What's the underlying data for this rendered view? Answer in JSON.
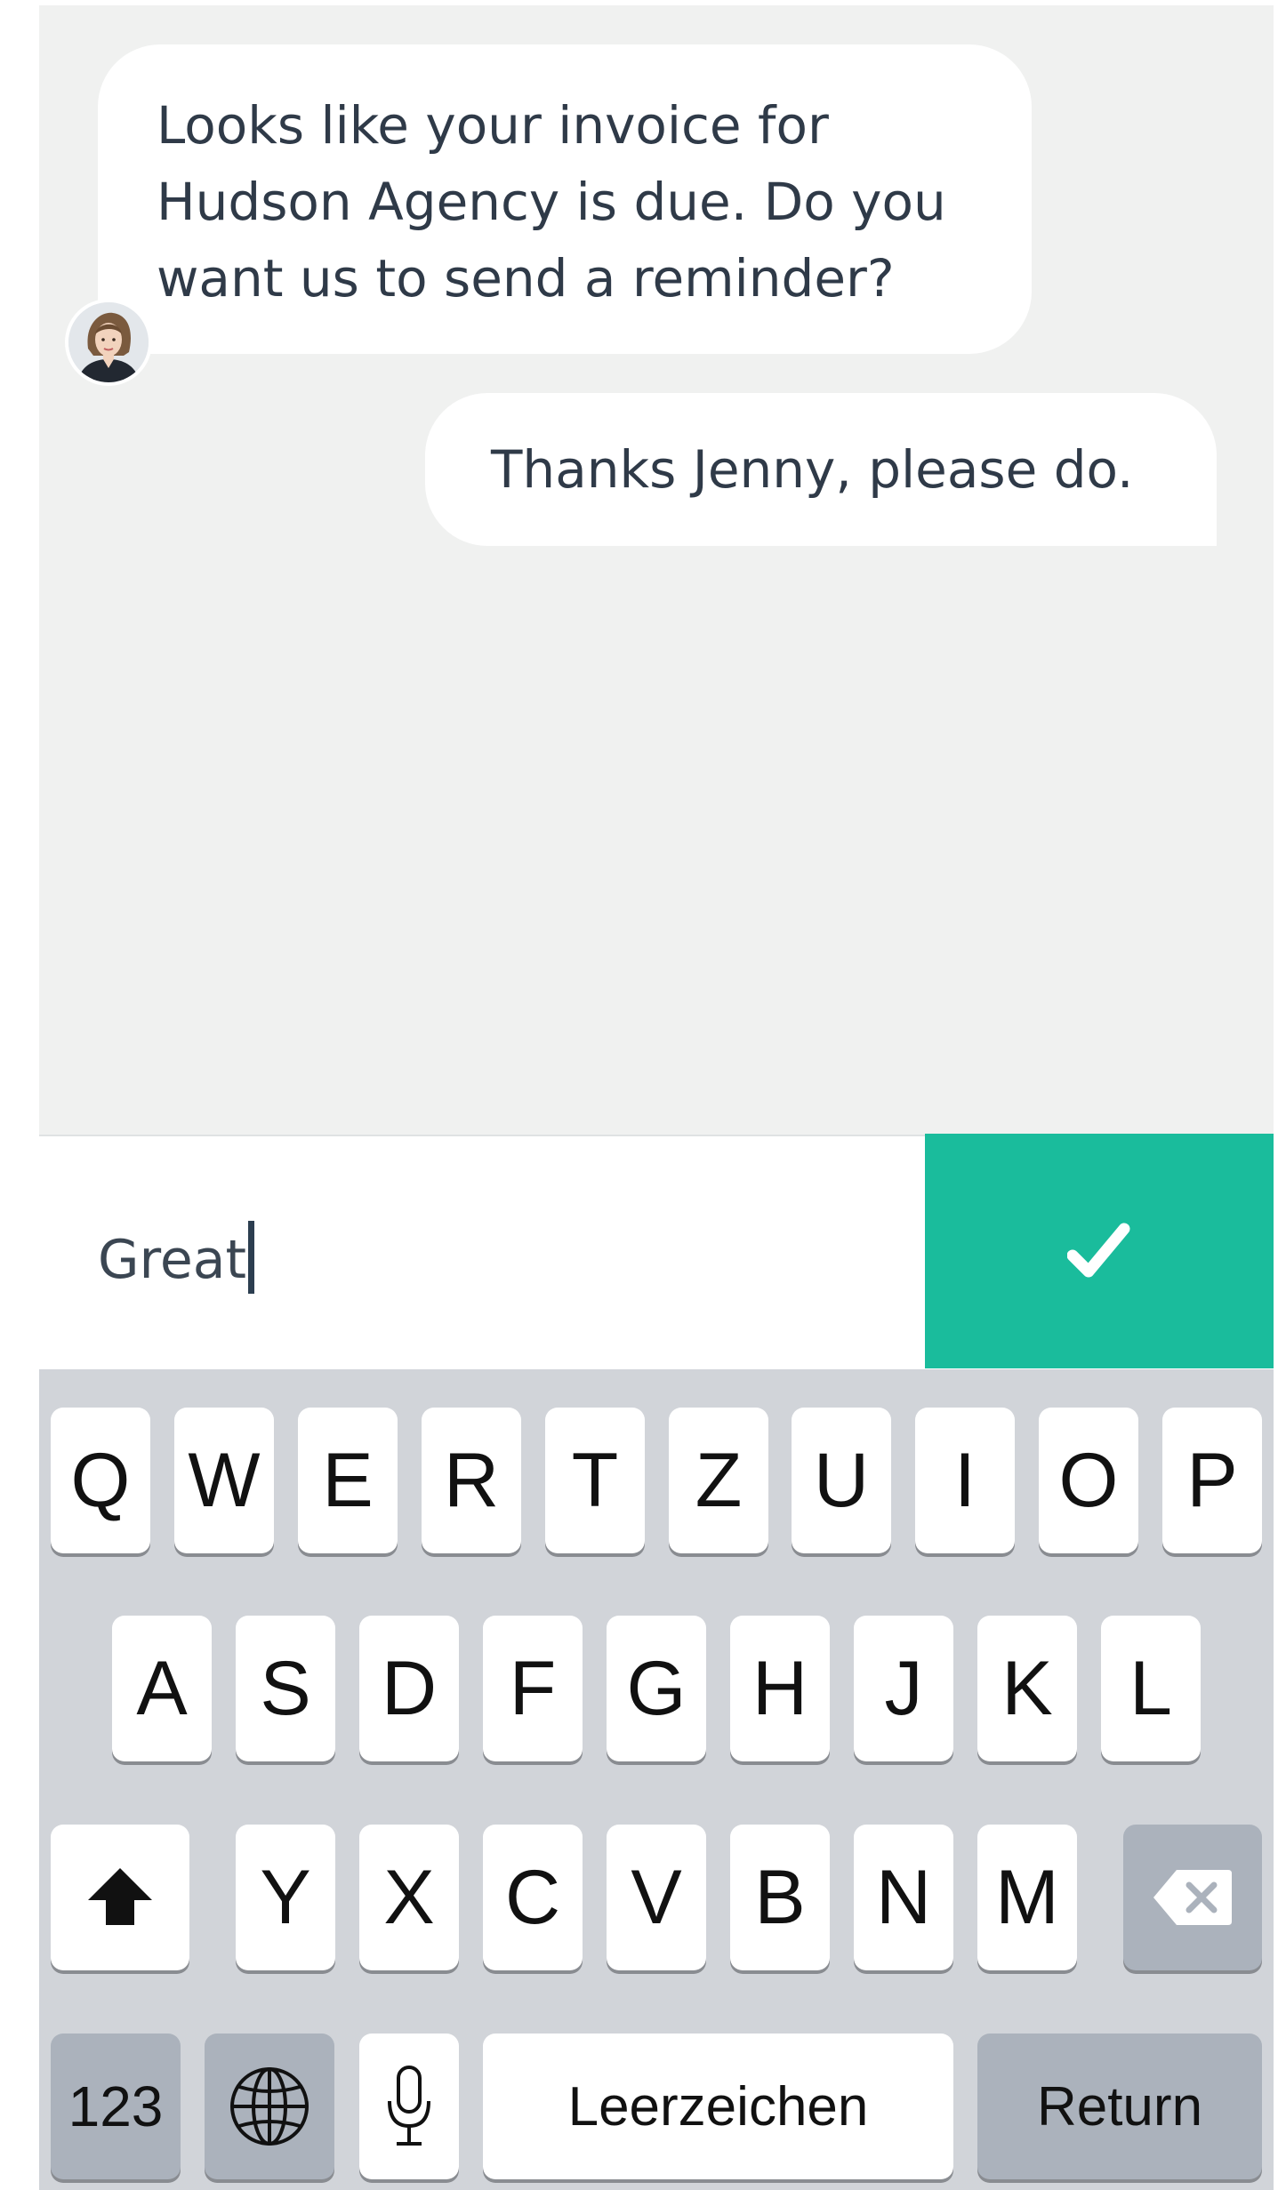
{
  "chat": {
    "messages": [
      {
        "sender": "agent",
        "lines": [
          "Looks like your invoice for",
          "Hudson Agency is due. Do you",
          "want us to send a reminder?"
        ]
      },
      {
        "sender": "user",
        "text": "Thanks Jenny, please do."
      }
    ]
  },
  "composer": {
    "value": "Great",
    "send_icon": "checkmark-icon",
    "accent_color": "#1abc9c"
  },
  "keyboard": {
    "row1": [
      "Q",
      "W",
      "E",
      "R",
      "T",
      "Z",
      "U",
      "I",
      "O",
      "P"
    ],
    "row2": [
      "A",
      "S",
      "D",
      "F",
      "G",
      "H",
      "J",
      "K",
      "L"
    ],
    "row3": [
      "Y",
      "X",
      "C",
      "V",
      "B",
      "N",
      "M"
    ],
    "numbers_label": "123",
    "space_label": "Leerzeichen",
    "return_label": "Return",
    "icons": {
      "shift": "shift-icon",
      "delete": "backspace-icon",
      "globe": "globe-icon",
      "dictation": "microphone-icon"
    }
  }
}
